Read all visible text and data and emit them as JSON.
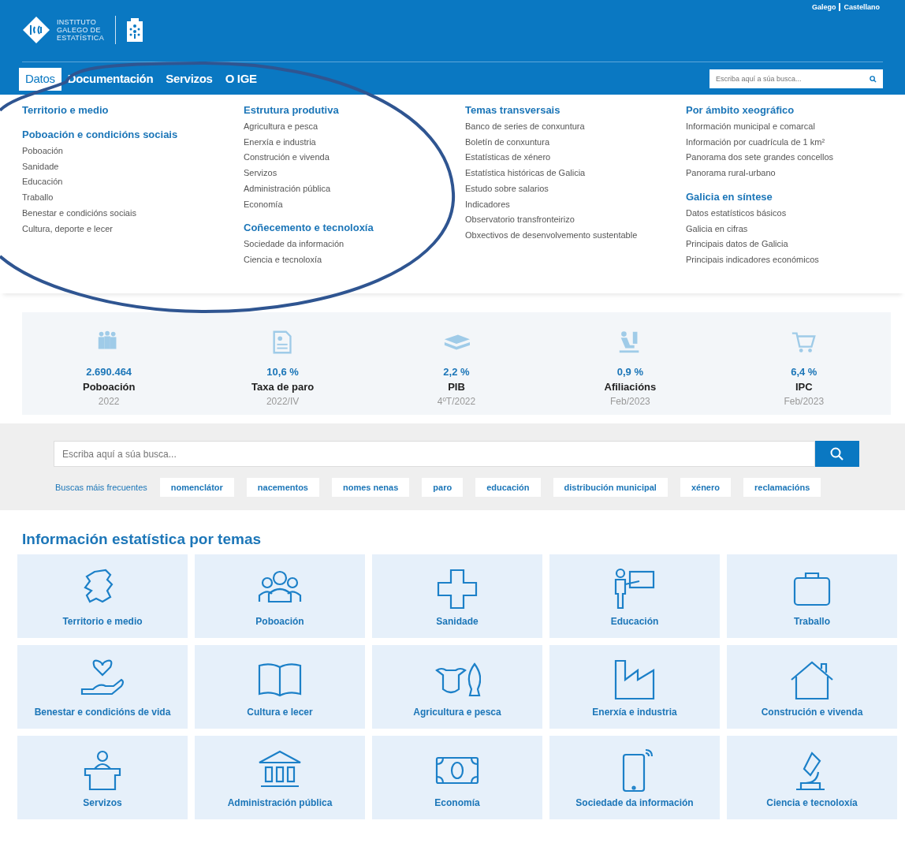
{
  "header": {
    "logo_lines": [
      "INSTITUTO",
      "GALEGO DE",
      "ESTATÍSTICA"
    ],
    "languages": [
      "Galego",
      "Castellano"
    ]
  },
  "nav": {
    "tabs": [
      {
        "label": "Datos",
        "selected": true
      },
      {
        "label": "Documentación",
        "selected": false
      },
      {
        "label": "Servizos",
        "selected": false
      },
      {
        "label": "O IGE",
        "selected": false
      }
    ],
    "search": {
      "placeholder": "Escriba aquí a súa busca..."
    }
  },
  "menu": {
    "columns": [
      {
        "groups": [
          {
            "heading": "Territorio e medio"
          },
          {
            "heading": "Poboación e condicións sociais",
            "items": [
              "Poboación",
              "Sanidade",
              "Educación",
              "Traballo",
              "Benestar e condicións sociais",
              "Cultura, deporte e lecer"
            ]
          }
        ]
      },
      {
        "groups": [
          {
            "heading": "Estrutura produtiva",
            "items": [
              "Agricultura e pesca",
              "Enerxía e industria",
              "Construción e vivenda",
              "Servizos",
              "Administración pública",
              "Economía"
            ]
          },
          {
            "heading": "Coñecemento e tecnoloxía",
            "items": [
              "Sociedade da información",
              "Ciencia e tecnoloxía"
            ]
          }
        ]
      },
      {
        "groups": [
          {
            "heading": "Temas transversais",
            "items": [
              "Banco de series de conxuntura",
              "Boletín de conxuntura",
              "Estatísticas de xénero",
              "Estatística históricas de Galicia",
              "Estudo sobre salarios",
              "Indicadores",
              "Observatorio transfronteirizo",
              "Obxectivos de desenvolvemento sustentable"
            ]
          }
        ]
      },
      {
        "groups": [
          {
            "heading": "Por ámbito xeográfico",
            "items": [
              "Información municipal e comarcal",
              "Información por cuadrícula de 1 km²",
              "Panorama dos sete grandes concellos",
              "Panorama rural-urbano"
            ]
          },
          {
            "heading": "Galicia en síntese",
            "items": [
              "Datos estatísticos básicos",
              "Galicia en cifras",
              "Principais datos de Galicia",
              "Principais indicadores económicos"
            ]
          }
        ]
      }
    ]
  },
  "stats": [
    {
      "value": "2.690.464",
      "label": "Poboación",
      "period": "2022"
    },
    {
      "value": "10,6 %",
      "label": "Taxa de paro",
      "period": "2022/IV"
    },
    {
      "value": "2,2 %",
      "label": "PIB",
      "period": "4ºT/2022"
    },
    {
      "value": "0,9 %",
      "label": "Afiliacións",
      "period": "Feb/2023"
    },
    {
      "value": "6,4 %",
      "label": "IPC",
      "period": "Feb/2023"
    }
  ],
  "search": {
    "placeholder": "Escriba aquí a súa busca...",
    "frequent_label": "Buscas máis frecuentes",
    "tags": [
      "nomenclátor",
      "nacementos",
      "nomes nenas",
      "paro",
      "educación",
      "distribución municipal",
      "xénero",
      "reclamacións"
    ]
  },
  "topics": {
    "title": "Información estatística por temas",
    "tiles": [
      "Territorio e medio",
      "Poboación",
      "Sanidade",
      "Educación",
      "Traballo",
      "Benestar e condicións de vida",
      "Cultura e lecer",
      "Agricultura e pesca",
      "Enerxía e industria",
      "Construción e vivenda",
      "Servizos",
      "Administración pública",
      "Economía",
      "Sociedade da información",
      "Ciencia e tecnoloxía"
    ]
  },
  "annotation": {
    "kind": "ellipse"
  }
}
